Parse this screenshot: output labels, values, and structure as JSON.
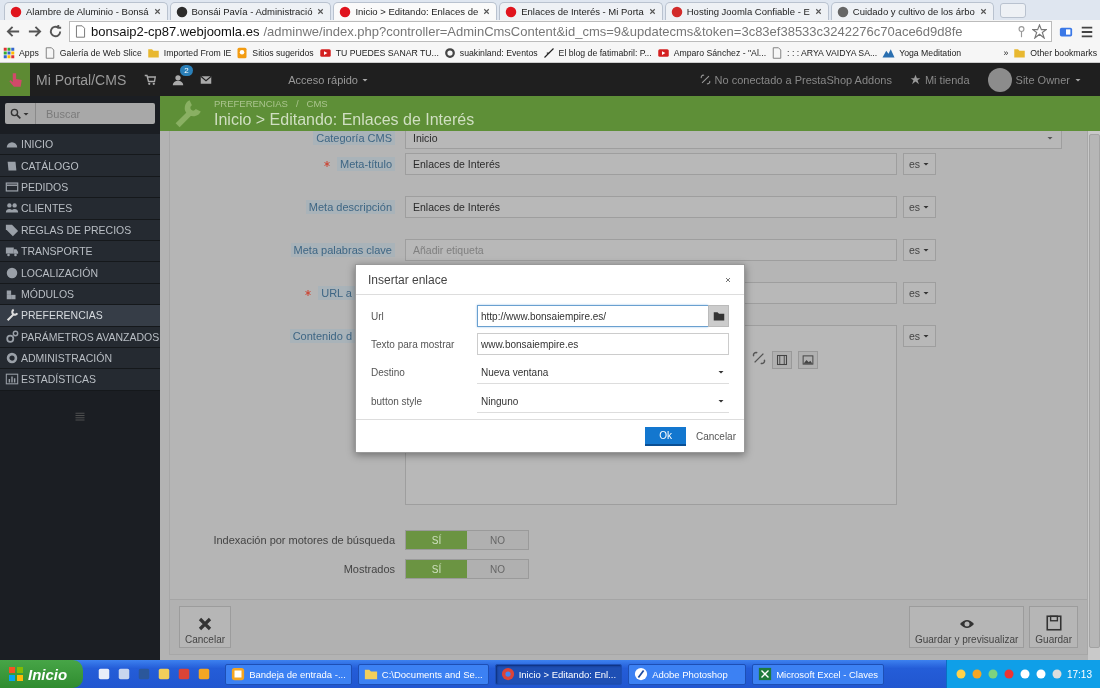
{
  "browser": {
    "tabs": [
      {
        "title": "Alambre de Aluminio - Bonsá",
        "color": "#e0141e",
        "selected": false
      },
      {
        "title": "Bonsái Pavía - Administració",
        "color": "#2b2b2b",
        "selected": false
      },
      {
        "title": "Inicio > Editando: Enlaces de",
        "color": "#e0141e",
        "selected": true
      },
      {
        "title": "Enlaces de Interés - Mi Porta",
        "color": "#e0141e",
        "selected": false
      },
      {
        "title": "Hosting Joomla Confiable - E",
        "color": "#d22a2a",
        "selected": false
      },
      {
        "title": "Cuidado y cultivo de los árbo",
        "color": "#666666",
        "selected": false
      }
    ],
    "address": {
      "host": "bonsaip2-cp87.webjoomla.es",
      "path": "/adminwe/index.php?controller=AdminCmsContent&id_cms=9&updatecms&token=3c83ef38533c3242276c70ace6d9d8fe"
    },
    "bookmarks": [
      {
        "label": "Apps",
        "kind": "apps"
      },
      {
        "label": "Galería de Web Slice",
        "kind": "page"
      },
      {
        "label": "Imported From IE",
        "kind": "folder"
      },
      {
        "label": "Sitios sugeridos",
        "kind": "orange"
      },
      {
        "label": "TU PUEDES SANAR TU...",
        "kind": "video"
      },
      {
        "label": "suakinland: Eventos",
        "kind": "gear"
      },
      {
        "label": "El blog de fatimabril: P...",
        "kind": "script"
      },
      {
        "label": "Amparo Sánchez - \"Al...",
        "kind": "video"
      },
      {
        "label": ": : : ARYA VAIDYA SA...",
        "kind": "page"
      },
      {
        "label": "Yoga Meditation",
        "kind": "mountain"
      }
    ],
    "bookmarks_more": "»",
    "other_bookmarks": "Other bookmarks"
  },
  "admin": {
    "brand": "Mi Portal/CMS",
    "notifications": "2",
    "quick_access": "Acceso rápido",
    "addons_status": "No conectado a PrestaShop Addons",
    "shop_link": "Mi tienda",
    "user": "Site Owner"
  },
  "sidebar": {
    "search_placeholder": "Buscar",
    "items": [
      {
        "label": "INICIO",
        "kind": "dashboard",
        "selected": false
      },
      {
        "label": "CATÁLOGO",
        "kind": "catalog",
        "selected": false
      },
      {
        "label": "PEDIDOS",
        "kind": "orders",
        "selected": false
      },
      {
        "label": "CLIENTES",
        "kind": "customers",
        "selected": false
      },
      {
        "label": "REGLAS DE PRECIOS",
        "kind": "prices",
        "selected": false
      },
      {
        "label": "TRANSPORTE",
        "kind": "shipping",
        "selected": false
      },
      {
        "label": "LOCALIZACIÓN",
        "kind": "localization",
        "selected": false
      },
      {
        "label": "MÓDULOS",
        "kind": "modules",
        "selected": false
      },
      {
        "label": "PREFERENCIAS",
        "kind": "preferences",
        "selected": true
      },
      {
        "label": "PARÁMETROS AVANZADOS",
        "kind": "advanced",
        "selected": false
      },
      {
        "label": "ADMINISTRACIÓN",
        "kind": "admin",
        "selected": false
      },
      {
        "label": "ESTADÍSTICAS",
        "kind": "stats",
        "selected": false
      }
    ]
  },
  "page_header": {
    "breadcrumb": [
      "PREFERENCIAS",
      "CMS"
    ],
    "breadcrumb_separator": "/",
    "title": "Inicio > Editando: Enlaces de Interés"
  },
  "form": {
    "fields": [
      {
        "label": "Categoría CMS",
        "value": "Inicio",
        "kind": "select",
        "required": false
      },
      {
        "label": "Meta-título",
        "value": "Enlaces de Interés",
        "kind": "text",
        "required": true,
        "lang": "es"
      },
      {
        "label": "Meta descripción",
        "value": "Enlaces de Interés",
        "kind": "text",
        "required": false,
        "lang": "es"
      },
      {
        "label": "Meta palabras clave",
        "placeholder": "Añadir etiqueta",
        "kind": "text",
        "required": false,
        "lang": "es"
      },
      {
        "label": "URL a",
        "kind": "covered",
        "required": true,
        "lang": "es"
      },
      {
        "label": "Contenido d",
        "kind": "editor",
        "required": false,
        "lang": "es"
      }
    ],
    "toggles": [
      {
        "label": "Indexación por motores de búsqueda",
        "options": [
          {
            "label": "SÍ",
            "selected": true
          },
          {
            "label": "NO",
            "selected": false
          }
        ]
      },
      {
        "label": "Mostrados",
        "options": [
          {
            "label": "SÍ",
            "selected": true
          },
          {
            "label": "NO",
            "selected": false
          }
        ]
      }
    ],
    "footer": {
      "cancel": "Cancelar",
      "preview": "Guardar y previsualizar",
      "save": "Guardar"
    }
  },
  "dialog": {
    "title": "Insertar enlace",
    "fields": [
      {
        "label": "Url",
        "value": "http://www.bonsaiempire.es/",
        "kind": "browse",
        "focused": true
      },
      {
        "label": "Texto para mostrar",
        "value": "www.bonsaiempire.es",
        "kind": "text",
        "focused": false
      },
      {
        "label": "Destino",
        "value": "Nueva ventana",
        "kind": "select",
        "focused": false
      },
      {
        "label": "button style",
        "value": "Ninguno",
        "kind": "select",
        "focused": false
      }
    ],
    "buttons": [
      {
        "label": "Ok",
        "primary": true
      },
      {
        "label": "Cancelar",
        "primary": false
      }
    ]
  },
  "taskbar": {
    "start": "Inicio",
    "tasks": [
      {
        "label": "Bandeja de entrada -...",
        "kind": "mail",
        "selected": false
      },
      {
        "label": "C:\\Documents and Se...",
        "kind": "folder",
        "selected": false
      },
      {
        "label": "Inicio > Editando: Enl...",
        "kind": "browser",
        "selected": true
      },
      {
        "label": "Adobe Photoshop",
        "kind": "photoshop",
        "selected": false
      },
      {
        "label": "Microsoft Excel - Claves",
        "kind": "excel",
        "selected": false
      }
    ],
    "clock": "17:13"
  }
}
